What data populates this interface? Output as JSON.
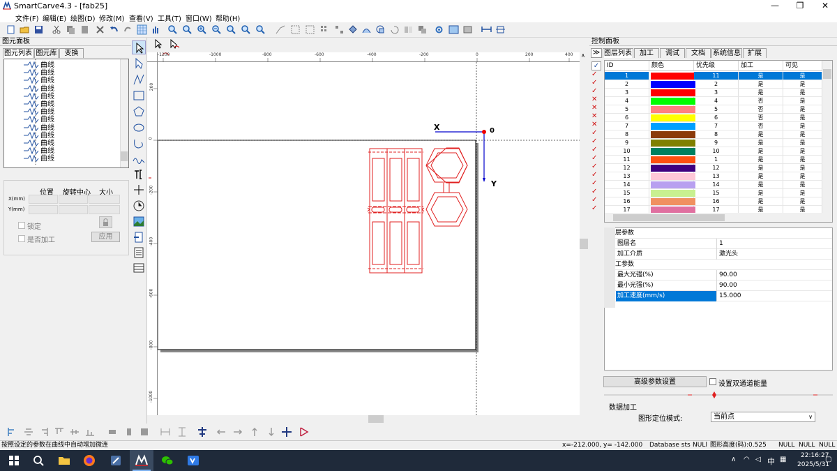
{
  "window": {
    "title": "SmartCarve4.3 - [fab25]",
    "minimize": "—",
    "maximize": "❐",
    "close": "✕"
  },
  "menu": [
    "文件(F)",
    "编辑(E)",
    "绘图(D)",
    "修改(M)",
    "查看(V)",
    "工具(T)",
    "窗口(W)",
    "帮助(H)"
  ],
  "left_panel": {
    "header": "图元面板",
    "tabs": [
      "图元列表",
      "图元库",
      "变换"
    ],
    "tree_items": [
      "曲线",
      "曲线",
      "曲线",
      "曲线",
      "曲线",
      "曲线",
      "曲线",
      "曲线",
      "曲线",
      "曲线",
      "曲线",
      "曲线",
      "曲线"
    ],
    "prop_cols": [
      "位置",
      "旋转中心",
      "大小"
    ],
    "prop_rows": [
      "X(mm)",
      "Y(mm)"
    ],
    "lock_label": "锁定",
    "process_label": "是否加工",
    "apply_label": "应用"
  },
  "canvas": {
    "origin_label": "0",
    "x_label": "X",
    "y_label": "Y",
    "ruler_h": [
      "-1200",
      "-1000",
      "-800",
      "-600",
      "-400",
      "-200",
      "0",
      "200",
      "400"
    ],
    "ruler_v": [
      "200",
      "0",
      "-200",
      "-400",
      "-600",
      "-800",
      "-1000"
    ]
  },
  "right_panel": {
    "header": "控制面板",
    "tabs": [
      "图层列表",
      "加工",
      "调试",
      "文档",
      "系统信息",
      "扩展"
    ],
    "columns": [
      "ID",
      "颜色",
      "优先级",
      "加工",
      "可见"
    ],
    "layers": [
      {
        "id": "1",
        "color": "#ff0000",
        "priority": "11",
        "process": "是",
        "visible": "是",
        "checked": true
      },
      {
        "id": "2",
        "color": "#0000ff",
        "priority": "2",
        "process": "是",
        "visible": "是",
        "checked": true
      },
      {
        "id": "3",
        "color": "#ff0000",
        "priority": "3",
        "process": "是",
        "visible": "是",
        "checked": true
      },
      {
        "id": "4",
        "color": "#00ff00",
        "priority": "4",
        "process": "否",
        "visible": "是",
        "checked": false
      },
      {
        "id": "5",
        "color": "#ff8080",
        "priority": "5",
        "process": "否",
        "visible": "是",
        "checked": false
      },
      {
        "id": "6",
        "color": "#ffff00",
        "priority": "6",
        "process": "否",
        "visible": "是",
        "checked": false
      },
      {
        "id": "7",
        "color": "#00a0ff",
        "priority": "7",
        "process": "否",
        "visible": "是",
        "checked": false
      },
      {
        "id": "8",
        "color": "#8b3a0a",
        "priority": "8",
        "process": "是",
        "visible": "是",
        "checked": true
      },
      {
        "id": "9",
        "color": "#808000",
        "priority": "9",
        "process": "是",
        "visible": "是",
        "checked": true
      },
      {
        "id": "10",
        "color": "#008060",
        "priority": "10",
        "process": "是",
        "visible": "是",
        "checked": true
      },
      {
        "id": "11",
        "color": "#ff5010",
        "priority": "1",
        "process": "是",
        "visible": "是",
        "checked": true
      },
      {
        "id": "12",
        "color": "#400080",
        "priority": "12",
        "process": "是",
        "visible": "是",
        "checked": true
      },
      {
        "id": "13",
        "color": "#ffc8d8",
        "priority": "13",
        "process": "是",
        "visible": "是",
        "checked": true
      },
      {
        "id": "14",
        "color": "#b8a0f0",
        "priority": "14",
        "process": "是",
        "visible": "是",
        "checked": true
      },
      {
        "id": "15",
        "color": "#c8f090",
        "priority": "15",
        "process": "是",
        "visible": "是",
        "checked": true
      },
      {
        "id": "16",
        "color": "#f09060",
        "priority": "16",
        "process": "是",
        "visible": "是",
        "checked": true
      },
      {
        "id": "17",
        "color": "#e070a0",
        "priority": "17",
        "process": "是",
        "visible": "是",
        "checked": true
      }
    ],
    "layer_params_title": "图层参数",
    "layer_name_label": "图层名",
    "layer_name_value": "1",
    "medium_label": "加工介质",
    "medium_value": "激光头",
    "process_params_title": "加工参数",
    "max_power_label": "最大光强(%)",
    "max_power_value": "90.00",
    "min_power_label": "最小光强(%)",
    "min_power_value": "90.00",
    "speed_label": "加工速度(mm/s)",
    "speed_value": "15.000",
    "advanced_button": "高级参数设置",
    "dual_channel_label": "设置双通道能量",
    "data_process_label": "数据加工",
    "locate_mode_label": "图形定位模式:",
    "locate_mode_value": "当前点"
  },
  "status": {
    "hint": "按照设定的参数在曲线中自动增加微连",
    "coords": "x=-212.000, y= -142.000",
    "db": "Database sts",
    "null1": "NULl",
    "height": "图形高度(码):0.525",
    "null2": "NULL",
    "null3": "NULL",
    "null4": "NULL"
  },
  "taskbar": {
    "time": "22:16:27",
    "date": "2025/5/31",
    "ime": "中"
  }
}
